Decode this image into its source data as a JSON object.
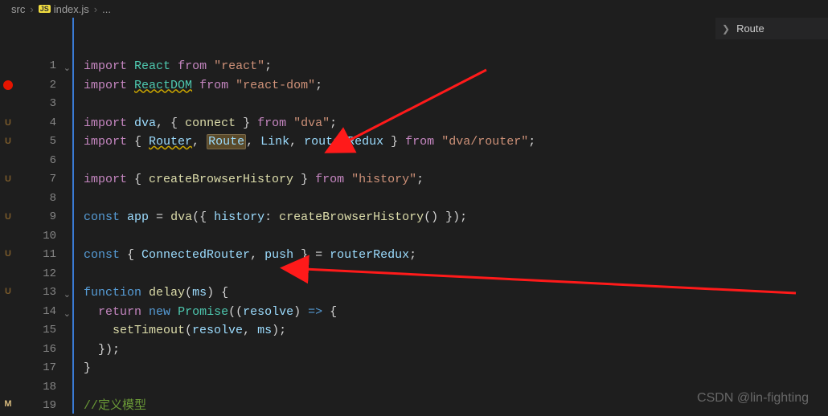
{
  "breadcrumb": {
    "folder": "src",
    "badge": "JS",
    "file": "index.js",
    "rest": "..."
  },
  "overview": {
    "label": "Route"
  },
  "left_markers": [
    "",
    "breakpoint",
    "",
    "u",
    "u",
    "",
    "u",
    "",
    "u",
    "",
    "u",
    "",
    "u",
    "",
    "",
    "",
    "",
    "",
    "m"
  ],
  "line_numbers": [
    "1",
    "2",
    "3",
    "4",
    "5",
    "6",
    "7",
    "8",
    "9",
    "10",
    "11",
    "12",
    "13",
    "14",
    "15",
    "16",
    "17",
    "18",
    "19"
  ],
  "folds": {
    "1": "v",
    "13": "v",
    "14": "v"
  },
  "code": {
    "l1": {
      "kw": "import",
      "sp": " ",
      "cls": "React",
      "sp2": " ",
      "from": "from",
      "sp3": " ",
      "str": "\"react\"",
      "semi": ";"
    },
    "l2": {
      "kw": "import",
      "sp": " ",
      "cls": "ReactDOM",
      "sp2": " ",
      "from": "from",
      "sp3": " ",
      "str": "\"react-dom\"",
      "semi": ";"
    },
    "l4": {
      "kw": "import",
      "sp": " ",
      "var": "dva",
      "comma": ", { ",
      "fn": "connect",
      "close": " } ",
      "from": "from",
      "sp2": " ",
      "str": "\"dva\"",
      "semi": ";"
    },
    "l5": {
      "kw": "import",
      "sp": " { ",
      "r1": "Router",
      "c1": ", ",
      "r2": "Route",
      "c2": ", ",
      "r3": "Link",
      "c3": ", ",
      "r4": "routerRedux",
      "close": " } ",
      "from": "from",
      "sp2": " ",
      "str": "\"dva/router\"",
      "semi": ";"
    },
    "l7": {
      "kw": "import",
      "sp": " { ",
      "fn": "createBrowserHistory",
      "close": " } ",
      "from": "from",
      "sp2": " ",
      "str": "\"history\"",
      "semi": ";"
    },
    "l9": {
      "kw": "const",
      "sp": " ",
      "var": "app",
      "eq": " = ",
      "fn": "dva",
      "p1": "({ ",
      "k": "history",
      "col": ": ",
      "fn2": "createBrowserHistory",
      "p2": "() });"
    },
    "l11": {
      "kw": "const",
      "sp": " { ",
      "v1": "ConnectedRouter",
      "c": ", ",
      "v2": "push",
      "close": " } = ",
      "var": "routerRedux",
      "semi": ";"
    },
    "l13": {
      "kw": "function",
      "sp": " ",
      "fn": "delay",
      "p": "(",
      "arg": "ms",
      "p2": ") {"
    },
    "l14": {
      "ind": "  ",
      "kw": "return",
      "sp": " ",
      "new": "new",
      "sp2": " ",
      "cls": "Promise",
      "p": "((",
      "arg": "resolve",
      "p2": ") ",
      "arrow": "=>",
      "p3": " {"
    },
    "l15": {
      "ind": "    ",
      "fn": "setTimeout",
      "p": "(",
      "a1": "resolve",
      "c": ", ",
      "a2": "ms",
      "p2": ");"
    },
    "l16": {
      "ind": "  ",
      "close": "});"
    },
    "l17": {
      "close": "}"
    },
    "l19": {
      "cmt": "//定义模型"
    }
  },
  "watermark": "CSDN @lin-fighting"
}
